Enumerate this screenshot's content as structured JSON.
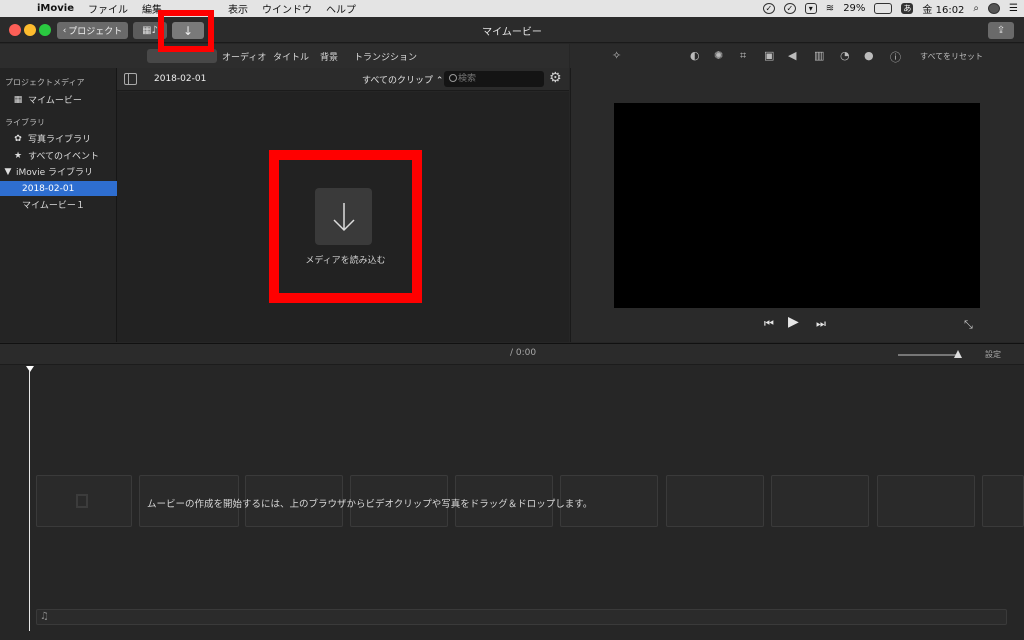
{
  "menubar": {
    "app_name": "iMovie",
    "items": [
      "ファイル",
      "編集",
      "表示",
      "ウインドウ",
      "ヘルプ"
    ],
    "battery": "29%",
    "input_method": "あ",
    "clock": "金 16:02"
  },
  "toolbar": {
    "projects_label": "プロジェクト",
    "window_title": "マイムービー",
    "import_arrow": "↓"
  },
  "tabs": [
    "オーディオ",
    "タイトル",
    "背景",
    "トランジション"
  ],
  "sidebar": {
    "project_media_header": "プロジェクトメディア",
    "project_item": "マイムービー",
    "library_header": "ライブラリ",
    "photo_library": "写真ライブラリ",
    "all_events": "すべてのイベント",
    "imovie_library": "iMovie ライブラリ",
    "selected_event": "2018-02-01",
    "movie_item": "マイムービー１"
  },
  "browser": {
    "date": "2018-02-01",
    "filter": "すべてのクリップ ⌃",
    "search_placeholder": "検索",
    "import_label": "メディアを読み込む"
  },
  "viewer": {
    "reset_label": "すべてをリセット"
  },
  "timeline": {
    "time": "/ 0:00",
    "settings_label": "設定",
    "hint": "ムービーの作成を開始するには、上のブラウザからビデオクリップや写真をドラッグ＆ドロップします。"
  }
}
